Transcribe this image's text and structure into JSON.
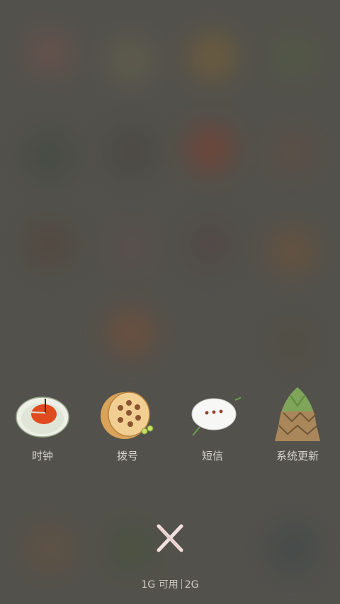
{
  "recent_apps": [
    {
      "label": "时钟",
      "icon": "clock-icon"
    },
    {
      "label": "拨号",
      "icon": "dialer-icon"
    },
    {
      "label": "短信",
      "icon": "messages-icon"
    },
    {
      "label": "系统更新",
      "icon": "system-update-icon"
    }
  ],
  "memory": {
    "available": "1G 可用",
    "total": "2G"
  },
  "colors": {
    "background": "#5a5853",
    "label": "#d9d6cf"
  }
}
